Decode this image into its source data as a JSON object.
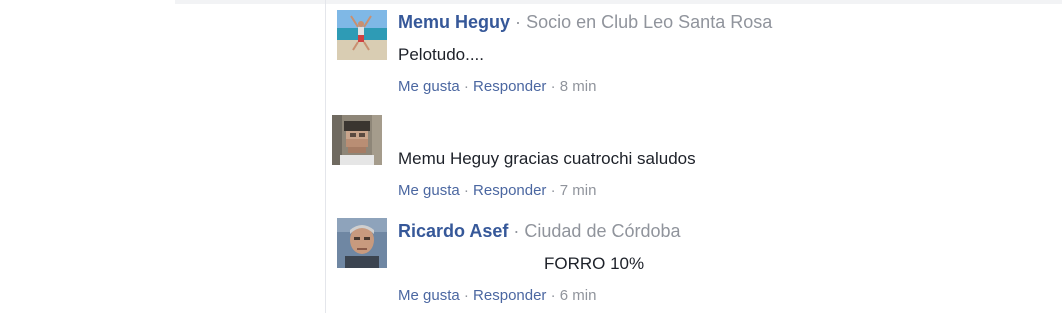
{
  "comments": [
    {
      "author": "Memu Heguy",
      "subtitle": "Socio en Club Leo Santa Rosa",
      "text": "Pelotudo....",
      "like": "Me gusta",
      "reply": "Responder",
      "time": "8 min"
    },
    {
      "author": "",
      "subtitle": "",
      "text": "Memu Heguy gracias cuatrochi saludos",
      "like": "Me gusta",
      "reply": "Responder",
      "time": "7 min"
    },
    {
      "author": "Ricardo Asef",
      "subtitle": "Ciudad de Córdoba",
      "text": "FORRO 10%",
      "like": "Me gusta",
      "reply": "Responder",
      "time": "6 min"
    }
  ],
  "separators": {
    "middle_dot": "·"
  },
  "colors": {
    "author_link": "#365899",
    "action_link": "#4b67a1",
    "meta_gray": "#90949c",
    "body_text": "#1d2129",
    "divider": "#e4e6eb"
  }
}
